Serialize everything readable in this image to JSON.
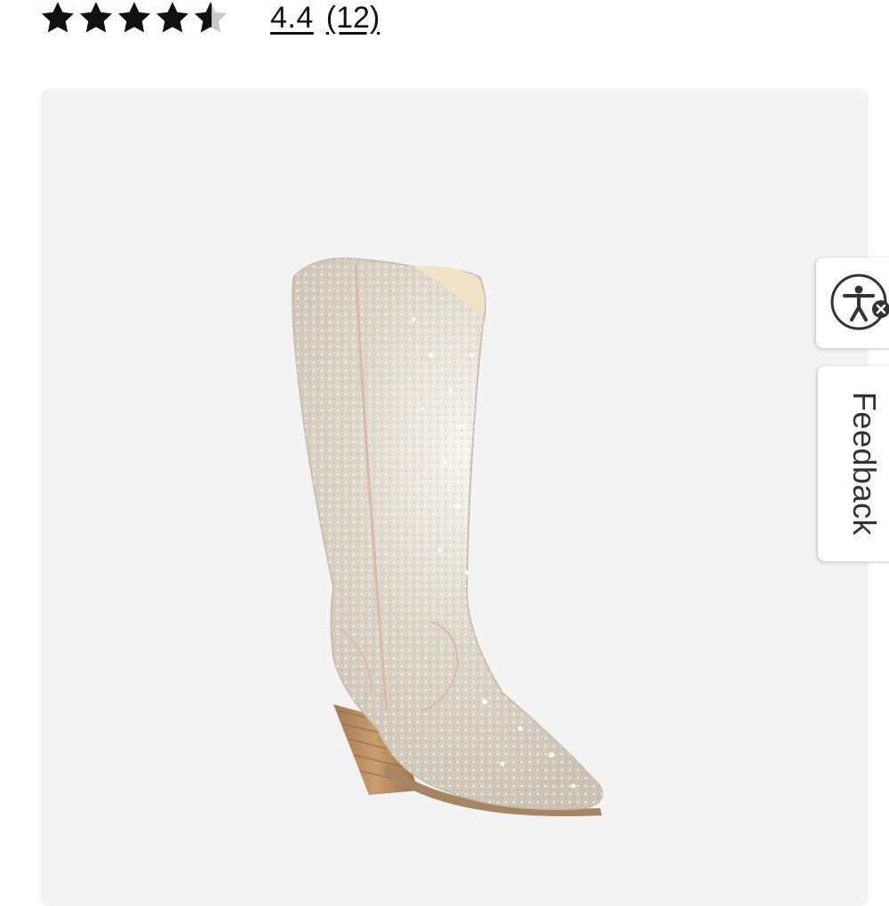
{
  "rating": {
    "stars_value": 4.4,
    "stars_max": 5,
    "value_label": "4.4",
    "count_label": "(12)",
    "star_color": "#111111",
    "star_empty_color": "#c8c8c8"
  },
  "product": {
    "image_icon": "crystal-western-boot-image",
    "background_color": "#f3f3f3"
  },
  "side_tabs": {
    "accessibility_icon": "accessibility-icon",
    "feedback_label": "Feedback"
  }
}
